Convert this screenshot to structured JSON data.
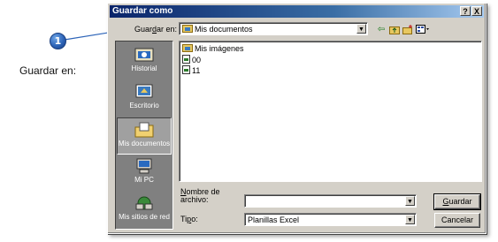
{
  "callout": {
    "number": "1",
    "label": "Guardar en:"
  },
  "dialog": {
    "title": "Guardar como",
    "help_button": "?",
    "close_button": "X",
    "save_in": {
      "label_pre": "Guar",
      "label_accel": "d",
      "label_post": "ar en:",
      "value": "Mis documentos"
    },
    "toolbar": {
      "icons": [
        "back-arrow-icon",
        "up-folder-icon",
        "new-folder-icon",
        "views-menu-icon"
      ]
    },
    "places": [
      {
        "label": "Historial",
        "icon": "history-icon",
        "selected": false
      },
      {
        "label": "Escritorio",
        "icon": "desktop-icon",
        "selected": false
      },
      {
        "label": "Mis documentos",
        "icon": "my-documents-icon",
        "selected": true
      },
      {
        "label": "Mi PC",
        "icon": "my-computer-icon",
        "selected": false
      },
      {
        "label": "Mis sitios de red",
        "icon": "network-places-icon",
        "selected": false
      }
    ],
    "files": [
      {
        "name": "Mis imágenes",
        "icon": "folder-icon"
      },
      {
        "name": "00",
        "icon": "excel-file-icon"
      },
      {
        "name": "11",
        "icon": "excel-file-icon"
      }
    ],
    "filename": {
      "label_accel": "N",
      "label_rest": "ombre de",
      "label_line2": "archivo:",
      "value": ""
    },
    "filetype": {
      "label_pre": "Ti",
      "label_accel": "p",
      "label_post": "o:",
      "value": "Planillas Excel"
    },
    "buttons": {
      "save_accel": "G",
      "save_rest": "uardar",
      "cancel": "Cancelar"
    }
  }
}
